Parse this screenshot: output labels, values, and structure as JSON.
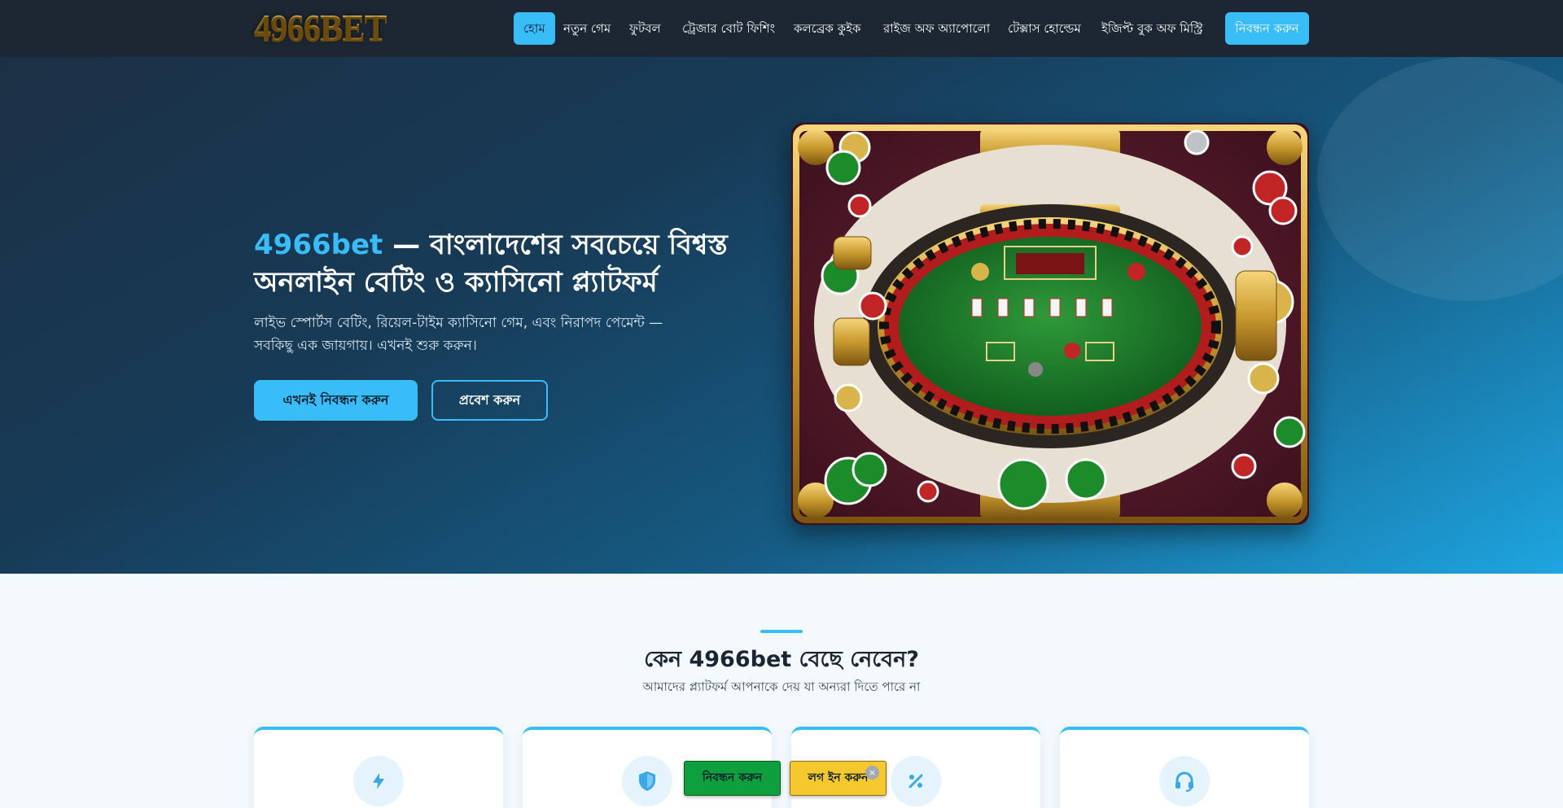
{
  "header": {
    "logo_text": "4966BET",
    "nav": [
      {
        "label": "হোম",
        "active": true
      },
      {
        "label": "নতুন গেম"
      },
      {
        "label": "ফুটবল"
      },
      {
        "label": "ট্রেজার বোট ফিশিং"
      },
      {
        "label": "কলব্রেক কুইক"
      },
      {
        "label": "রাইজ অফ অ্যাপোলো"
      },
      {
        "label": "টেক্সাস হোল্ডেম"
      },
      {
        "label": "ইজিপ্ট বুক অফ মিস্ট্রি"
      }
    ],
    "cta_label": "নিবন্ধন করুন"
  },
  "hero": {
    "title_brand": "4966bet",
    "title_rest": " — বাংলাদেশের সবচেয়ে বিশ্বস্ত অনলাইন বেটিং ও ক্যাসিনো প্ল্যাটফর্ম",
    "subtitle": "লাইভ স্পোর্টস বেটিং, রিয়েল-টাইম ক্যাসিনো গেম, এবং নিরাপদ পেমেন্ট — সবকিছু এক জায়গায়। এখনই শুরু করুন।",
    "primary_button": "এখনই নিবন্ধন করুন",
    "secondary_button": "প্রবেশ করুন"
  },
  "features": {
    "title": "কেন 4966bet বেছে নেবেন?",
    "subtitle": "আমাদের প্ল্যাটফর্ম আপনাকে দেয় যা অন্যরা দিতে পারে না",
    "cards": [
      {
        "icon": "lightning-icon"
      },
      {
        "icon": "shield-icon"
      },
      {
        "icon": "percent-icon"
      },
      {
        "icon": "headset-icon"
      }
    ]
  },
  "floating": {
    "register_label": "নিবন্ধন করুন",
    "login_label": "লগ ইন করুন",
    "close_glyph": "×"
  },
  "colors": {
    "accent": "#38bdf8",
    "nav_bg": "#1c2733",
    "register_green": "#0e9f3e",
    "login_yellow": "#f5c92e"
  }
}
